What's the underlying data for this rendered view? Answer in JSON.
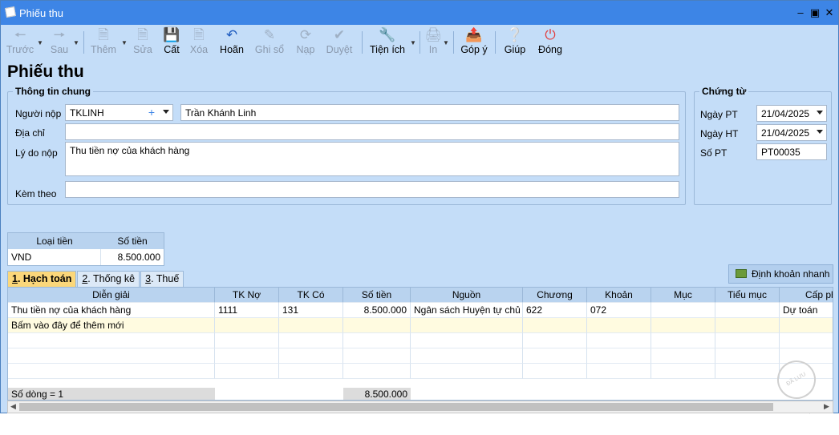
{
  "window": {
    "title": "Phiếu thu"
  },
  "toolbar": [
    {
      "label": "Trước",
      "icon": "arrow-left-icon",
      "enabled": false
    },
    {
      "label": "Sau",
      "icon": "arrow-right-icon",
      "enabled": false
    },
    {
      "label": "Thêm",
      "icon": "new-document-icon",
      "enabled": false
    },
    {
      "label": "Sửa",
      "icon": "edit-document-icon",
      "enabled": false
    },
    {
      "label": "Cất",
      "icon": "save-icon",
      "enabled": true
    },
    {
      "label": "Xóa",
      "icon": "delete-document-icon",
      "enabled": false
    },
    {
      "label": "Hoãn",
      "icon": "undo-icon",
      "enabled": true
    },
    {
      "label": "Ghi sổ",
      "icon": "pencil-icon",
      "enabled": false
    },
    {
      "label": "Nạp",
      "icon": "refresh-icon",
      "enabled": false
    },
    {
      "label": "Duyệt",
      "icon": "check-icon",
      "enabled": false
    },
    {
      "label": "Tiện ích",
      "icon": "tools-icon",
      "enabled": true
    },
    {
      "label": "In",
      "icon": "printer-icon",
      "enabled": false
    },
    {
      "label": "Góp ý",
      "icon": "feedback-icon",
      "enabled": true
    },
    {
      "label": "Giúp",
      "icon": "help-icon",
      "enabled": true
    },
    {
      "label": "Đóng",
      "icon": "power-icon",
      "enabled": true
    }
  ],
  "page_title": "Phiếu thu",
  "general": {
    "legend": "Thông tin chung",
    "payer_label": "Người nộp",
    "payer_code": "TKLINH",
    "payer_name": "Trần Khánh Linh",
    "address_label": "Địa chỉ",
    "address_value": "",
    "reason_label": "Lý do nộp",
    "reason_value": "Thu tiền nợ của khách hàng",
    "attach_label": "Kèm theo",
    "attach_value": ""
  },
  "voucher": {
    "legend": "Chứng từ",
    "date_pt_label": "Ngày PT",
    "date_pt_value": "21/04/2025",
    "date_ht_label": "Ngày HT",
    "date_ht_value": "21/04/2025",
    "number_label": "Số PT",
    "number_value": "PT00035"
  },
  "currency": {
    "headers": [
      "Loại tiền",
      "Số tiền"
    ],
    "row": [
      "VND",
      "8.500.000"
    ]
  },
  "tabs": [
    {
      "key": "1",
      "label": ". Hạch toán"
    },
    {
      "key": "2",
      "label": ". Thống kê"
    },
    {
      "key": "3",
      "label": ". Thuế"
    }
  ],
  "quick_button": "Định khoản nhanh",
  "grid": {
    "columns": [
      "Diễn giải",
      "TK Nợ",
      "TK Có",
      "Số tiền",
      "Nguồn",
      "Chương",
      "Khoản",
      "Mục",
      "Tiểu mục",
      "Cấp ph"
    ],
    "rows": [
      [
        "Thu tiền nợ của khách hàng",
        "1111",
        "131",
        "8.500.000",
        "Ngân sách Huyện tự chủ",
        "622",
        "072",
        "",
        "",
        "Dự toán"
      ]
    ],
    "new_row_hint": "Bấm vào đây để thêm mới",
    "footer_count": "Số dòng = 1",
    "footer_total": "8.500.000"
  },
  "stamp_text": "ĐÃ LƯU MẪU"
}
